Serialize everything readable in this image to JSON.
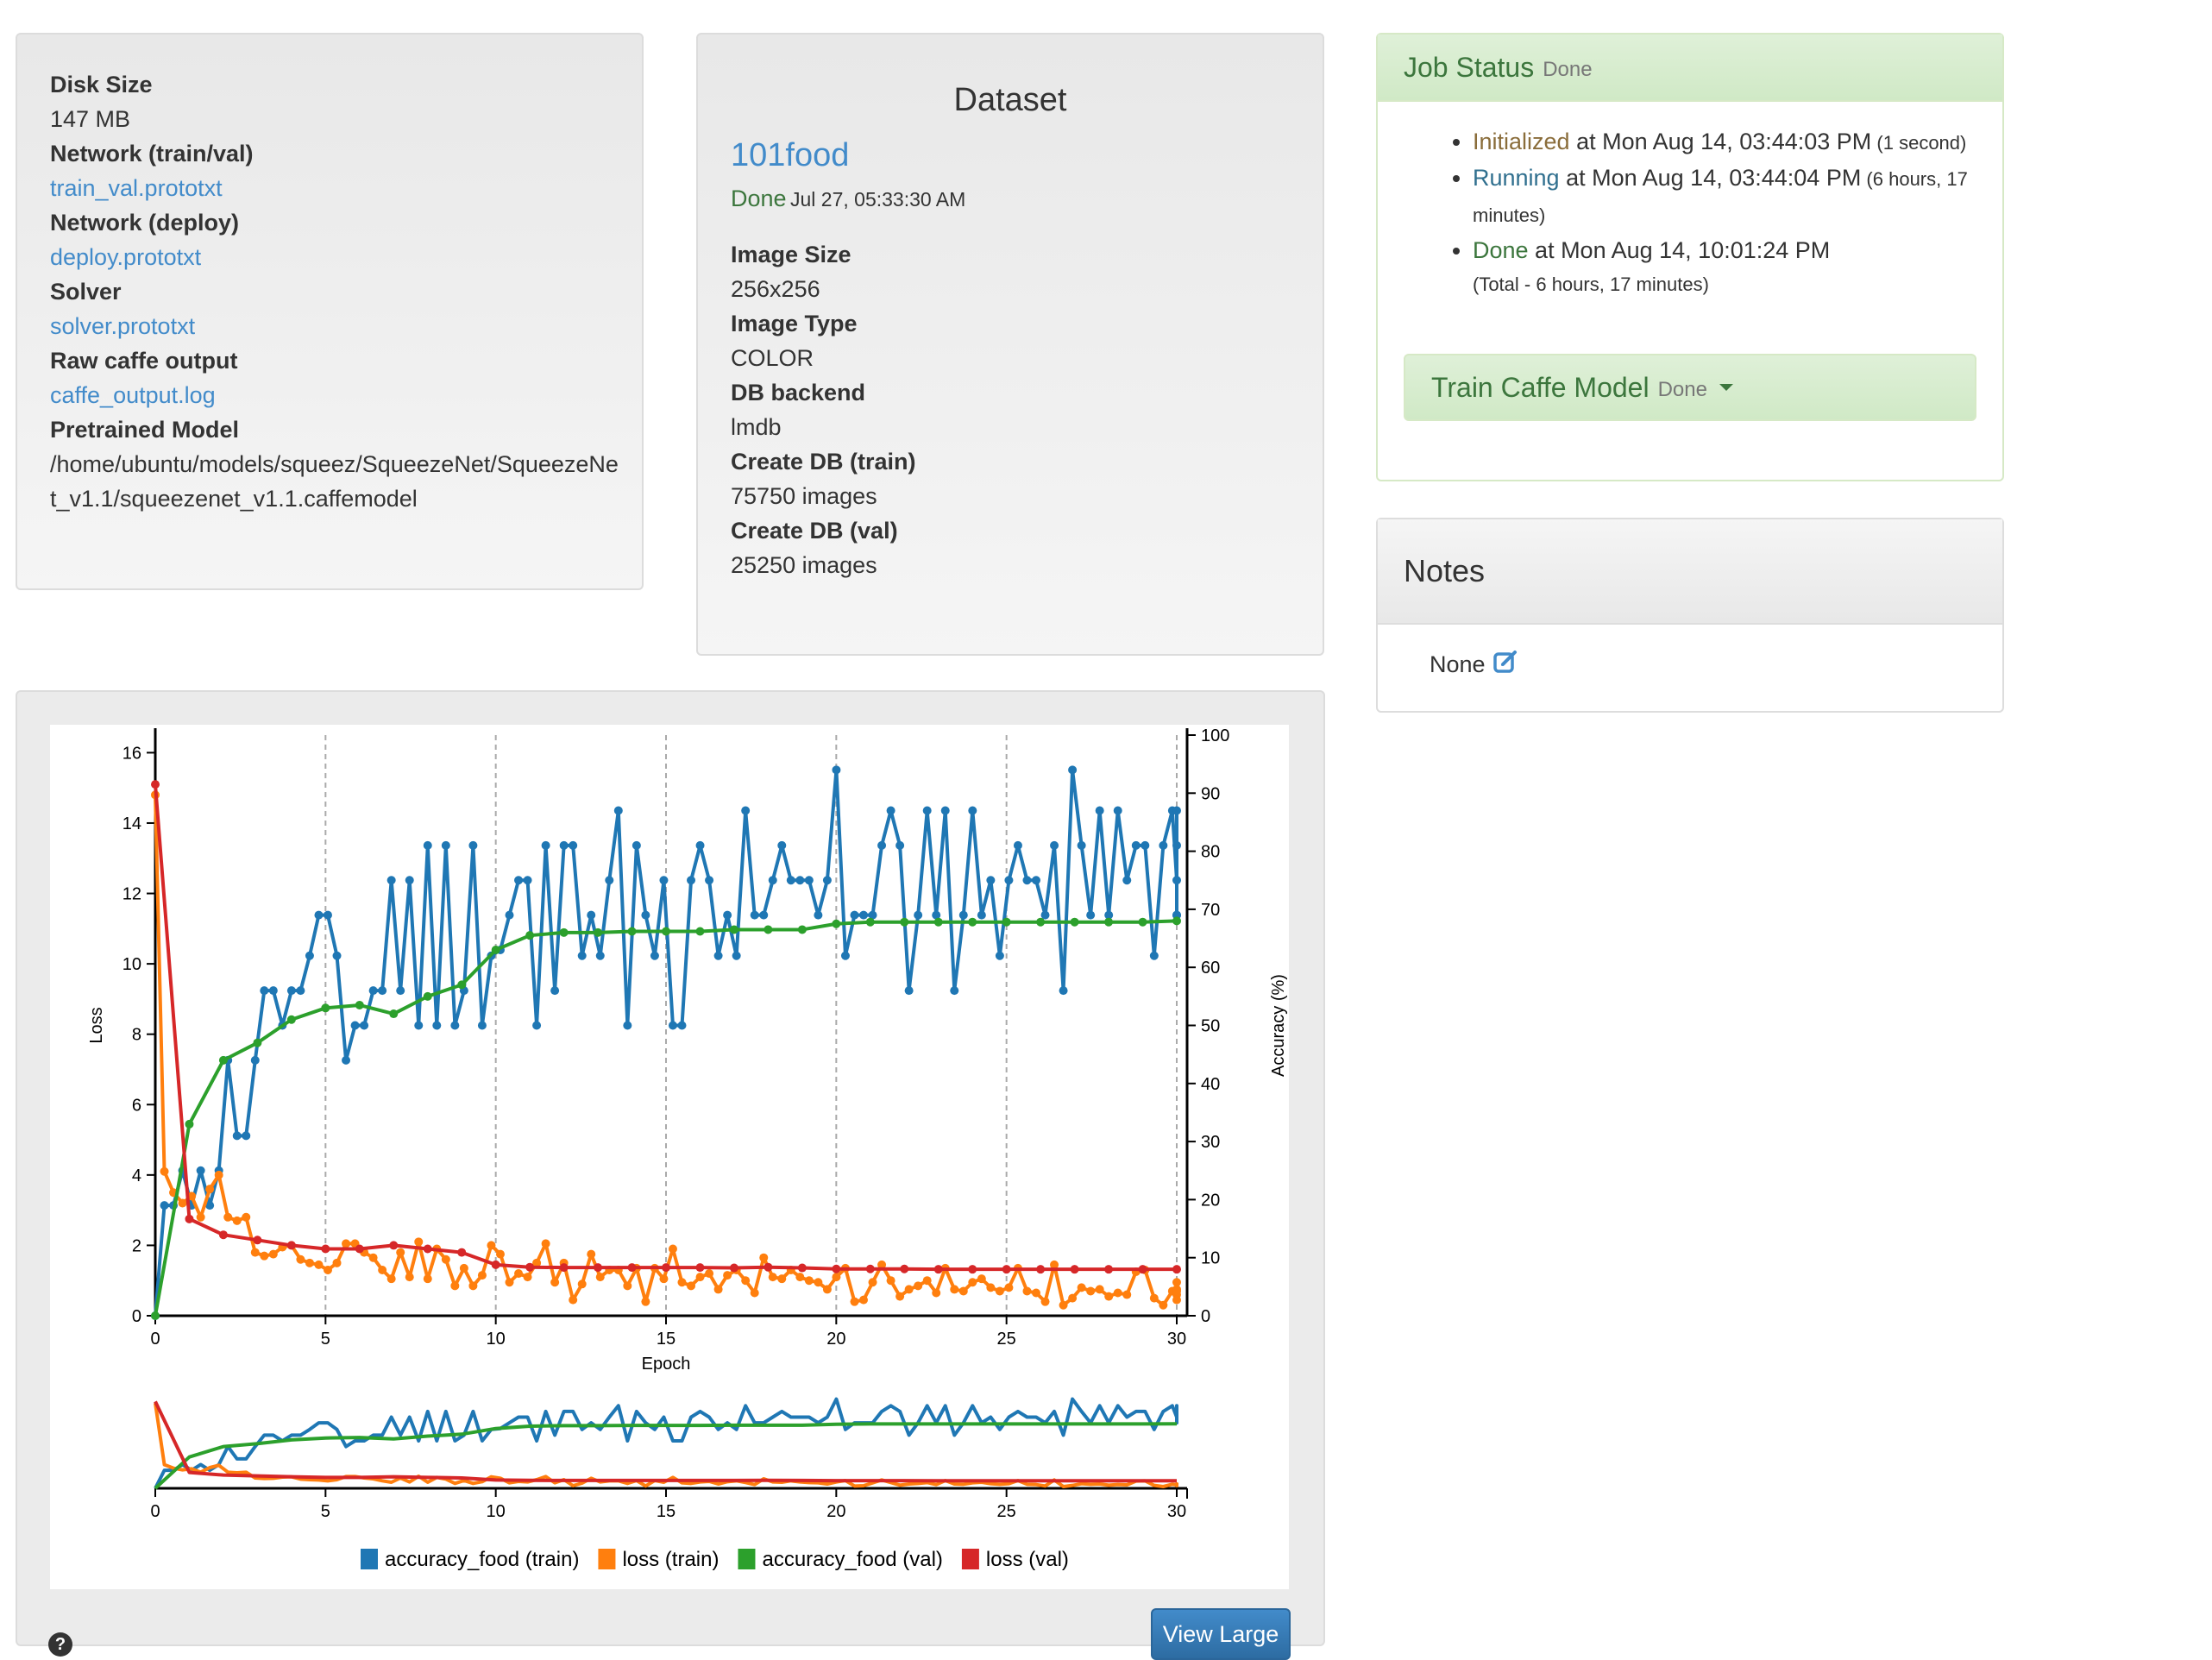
{
  "model_info": {
    "items": [
      {
        "label": "Disk Size",
        "value": "147 MB",
        "is_link": false
      },
      {
        "label": "Network (train/val)",
        "value": "train_val.prototxt",
        "is_link": true
      },
      {
        "label": "Network (deploy)",
        "value": "deploy.prototxt",
        "is_link": true
      },
      {
        "label": "Solver",
        "value": "solver.prototxt",
        "is_link": true
      },
      {
        "label": "Raw caffe output",
        "value": "caffe_output.log",
        "is_link": true
      },
      {
        "label": "Pretrained Model",
        "value": "/home/ubuntu/models/squeez/SqueezeNet/SqueezeNet_v1.1/squeezenet_v1.1.caffemodel",
        "is_link": false
      }
    ]
  },
  "dataset": {
    "title": "Dataset",
    "name": "101food",
    "status": "Done",
    "status_time": "Jul 27, 05:33:30 AM",
    "items": [
      {
        "label": "Image Size",
        "value": "256x256"
      },
      {
        "label": "Image Type",
        "value": "COLOR"
      },
      {
        "label": "DB backend",
        "value": "lmdb"
      },
      {
        "label": "Create DB (train)",
        "value": "75750 images"
      },
      {
        "label": "Create DB (val)",
        "value": "25250 images"
      }
    ]
  },
  "job_status": {
    "title": "Job Status",
    "state": "Done",
    "events": [
      {
        "state": "Initialized",
        "color": "#8a6d3b",
        "text": " at Mon Aug 14, 03:44:03 PM",
        "duration": "(1 second)"
      },
      {
        "state": "Running",
        "color": "#31708f",
        "text": " at Mon Aug 14, 03:44:04 PM",
        "duration": "(6 hours, 17 minutes)"
      },
      {
        "state": "Done",
        "color": "#3c763d",
        "text": " at Mon Aug 14, 10:01:24 PM",
        "duration": "(Total - 6 hours, 17 minutes)"
      }
    ],
    "task": {
      "label": "Train Caffe Model",
      "state": "Done"
    }
  },
  "notes": {
    "title": "Notes",
    "value": "None"
  },
  "buttons": {
    "view_large": "View Large",
    "help": "?"
  },
  "chart_data": {
    "type": "line",
    "xlabel": "Epoch",
    "ylabel_left": "Loss",
    "ylabel_right": "Accuracy (%)",
    "xlim": [
      0,
      30
    ],
    "ylim_left": [
      0,
      16.5
    ],
    "ylim_right": [
      0,
      100
    ],
    "xticks": [
      0,
      5,
      10,
      15,
      20,
      25,
      30
    ],
    "yticks_left": [
      0,
      2,
      4,
      6,
      8,
      10,
      12,
      14,
      16
    ],
    "yticks_right": [
      0,
      10,
      20,
      30,
      40,
      50,
      60,
      70,
      80,
      90,
      100
    ],
    "grid": "vertical dashed at x ticks",
    "legend_position": "bottom",
    "series": [
      {
        "name": "accuracy_food (train)",
        "color": "#1f77b4",
        "axis": "right",
        "x_step": 0.2667,
        "values": [
          0,
          19,
          19,
          25,
          19,
          25,
          19,
          25,
          44,
          31,
          31,
          44,
          56,
          56,
          50,
          56,
          56,
          62,
          69,
          69,
          62,
          44,
          50,
          50,
          56,
          56,
          75,
          56,
          75,
          50,
          81,
          50,
          81,
          50,
          56,
          81,
          50,
          62,
          63,
          69,
          75,
          75,
          50,
          81,
          56,
          81,
          81,
          62,
          69,
          62,
          75,
          87,
          50,
          81,
          69,
          62,
          75,
          50,
          50,
          75,
          81,
          75,
          62,
          69,
          62,
          87,
          69,
          69,
          75,
          81,
          75,
          75,
          75,
          69,
          75,
          94,
          62,
          69,
          69,
          69,
          81,
          87,
          81,
          56,
          69,
          87,
          69,
          87,
          56,
          69,
          87,
          69,
          75,
          62,
          75,
          81,
          75,
          75,
          69,
          81,
          56,
          94,
          81,
          69,
          87,
          69,
          87,
          75,
          81,
          81,
          62,
          81,
          87,
          75,
          69,
          81,
          69,
          87,
          69
        ]
      },
      {
        "name": "loss (train)",
        "color": "#ff7f0e",
        "axis": "left",
        "x_step": 0.2667,
        "values": [
          14.8,
          4.1,
          3.5,
          3.2,
          3.4,
          2.8,
          3.6,
          4.0,
          2.8,
          2.7,
          2.8,
          1.8,
          1.7,
          1.75,
          1.95,
          2.0,
          1.6,
          1.5,
          1.45,
          1.3,
          1.5,
          2.05,
          2.05,
          1.8,
          1.65,
          1.3,
          1.05,
          1.8,
          1.1,
          2.1,
          1.05,
          1.9,
          1.6,
          0.85,
          1.35,
          0.85,
          1.15,
          2.0,
          1.75,
          0.95,
          1.2,
          1.1,
          1.5,
          2.05,
          0.95,
          1.5,
          0.45,
          0.9,
          1.75,
          1.1,
          1.3,
          1.3,
          0.85,
          1.35,
          0.4,
          1.35,
          1.05,
          1.9,
          0.95,
          0.85,
          1.1,
          1.2,
          0.75,
          1.15,
          1.3,
          1.0,
          0.65,
          1.65,
          1.1,
          1.05,
          1.3,
          1.1,
          1.0,
          0.95,
          0.75,
          1.1,
          1.35,
          0.4,
          0.45,
          0.95,
          1.45,
          1.0,
          0.55,
          0.75,
          0.85,
          1.0,
          0.65,
          1.35,
          0.75,
          0.7,
          0.95,
          1.05,
          0.8,
          0.7,
          0.8,
          1.35,
          0.7,
          0.65,
          0.4,
          1.45,
          0.3,
          0.5,
          0.8,
          0.7,
          0.75,
          0.55,
          0.65,
          0.6,
          1.25,
          1.3,
          0.5,
          0.3,
          0.7,
          0.6,
          0.75,
          0.7,
          0.45,
          0.95
        ]
      },
      {
        "name": "accuracy_food (val)",
        "color": "#2ca02c",
        "axis": "right",
        "x": [
          0,
          1,
          2,
          3,
          4,
          5,
          6,
          7,
          8,
          9,
          10,
          11,
          12,
          13,
          14,
          15,
          16,
          17,
          18,
          19,
          20,
          21,
          22,
          23,
          24,
          25,
          26,
          27,
          28,
          29,
          30
        ],
        "values": [
          0,
          33,
          44,
          47,
          51,
          53,
          53.5,
          52,
          55,
          57,
          63,
          65.5,
          66,
          66,
          66.2,
          66.2,
          66.2,
          66.5,
          66.5,
          66.5,
          67.5,
          67.8,
          67.8,
          67.8,
          67.8,
          67.8,
          67.8,
          67.8,
          67.8,
          67.8,
          68
        ]
      },
      {
        "name": "loss (val)",
        "color": "#d62728",
        "axis": "left",
        "x": [
          0,
          1,
          2,
          3,
          4,
          5,
          6,
          7,
          8,
          9,
          10,
          11,
          12,
          13,
          14,
          15,
          16,
          17,
          18,
          19,
          20,
          21,
          22,
          23,
          24,
          25,
          26,
          27,
          28,
          29,
          30
        ],
        "values": [
          15.1,
          2.75,
          2.3,
          2.15,
          2.0,
          1.9,
          1.9,
          2.0,
          1.9,
          1.8,
          1.45,
          1.38,
          1.37,
          1.37,
          1.37,
          1.37,
          1.37,
          1.36,
          1.38,
          1.36,
          1.33,
          1.33,
          1.33,
          1.32,
          1.32,
          1.32,
          1.32,
          1.32,
          1.32,
          1.32,
          1.32
        ]
      }
    ]
  }
}
